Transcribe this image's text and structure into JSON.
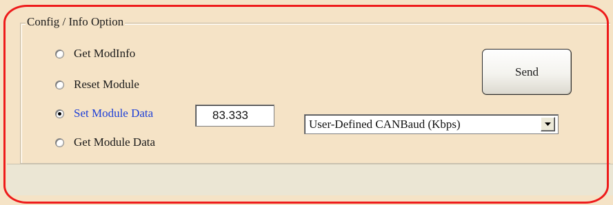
{
  "group": {
    "title": "Config / Info Option"
  },
  "options": [
    {
      "label": "Get ModInfo",
      "checked": false
    },
    {
      "label": "Reset Module",
      "checked": false
    },
    {
      "label": "Set Module Data",
      "checked": true
    },
    {
      "label": "Get Module Data",
      "checked": false
    }
  ],
  "module_data": {
    "value": "83.333"
  },
  "canbaud_select": {
    "selected": "User-Defined CANBaud (Kbps)"
  },
  "send_button": {
    "label": "Send"
  },
  "colors": {
    "background": "#f5e3c6",
    "selected_label": "#1d3fd8",
    "highlight_outline": "#ee1b1b"
  },
  "icons": {
    "dropdown": "chevron-down-icon"
  }
}
